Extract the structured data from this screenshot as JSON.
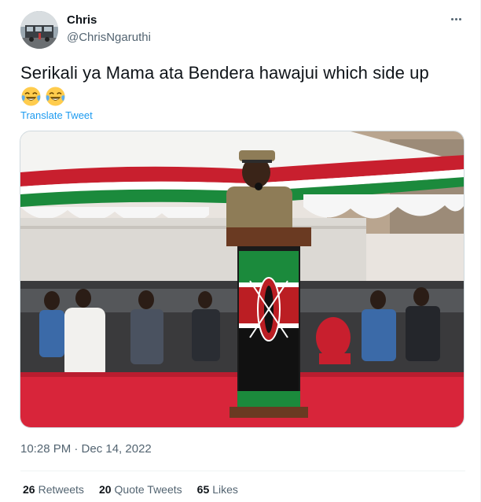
{
  "author": {
    "name": "Chris",
    "handle": "@ChrisNgaruthi"
  },
  "tweet": {
    "text": "Serikali ya Mama ata Bendera hawajui which side up",
    "emojis": [
      "face-with-tears-of-joy",
      "face-with-tears-of-joy"
    ],
    "translate_label": "Translate Tweet",
    "media_description_icon": "photo",
    "timestamp": "10:28 PM · Dec 14, 2022"
  },
  "stats": {
    "retweets": {
      "count": "26",
      "label": "Retweets"
    },
    "quote_tweets": {
      "count": "20",
      "label": "Quote Tweets"
    },
    "likes": {
      "count": "65",
      "label": "Likes"
    }
  },
  "colors": {
    "link": "#1d9bf0",
    "secondary_text": "#536471",
    "primary_text": "#0f1419",
    "flag_red": "#bb1e23",
    "flag_green": "#0f7a37",
    "flag_black": "#111111",
    "stage_red": "#d1283a"
  }
}
